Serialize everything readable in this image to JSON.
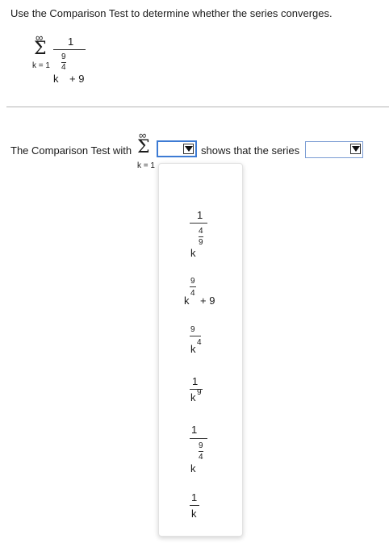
{
  "question": {
    "prompt": "Use the Comparison Test to determine whether the series converges.",
    "series": {
      "sum_upper": "∞",
      "sum_symbol": "Σ",
      "sum_lower": "k = 1",
      "numerator": "1",
      "base": "k",
      "exp_num": "9",
      "exp_den": "4",
      "tail": "+ 9"
    }
  },
  "answer": {
    "lead_text": "The Comparison Test with",
    "sum_upper": "∞",
    "sum_symbol": "Σ",
    "sum_lower": "k = 1",
    "middle_text": "shows that the series",
    "select1_value": "",
    "select2_value": ""
  },
  "dropdown_options": [
    {
      "id": "opt-1",
      "label": "1 / k^(4/9)",
      "numerator": "1",
      "base": "k",
      "exp_num": "4",
      "exp_den": "9"
    },
    {
      "id": "opt-2",
      "label": "k^(9/4) + 9 over 9",
      "numerator": "9",
      "base": "k",
      "exp": "4",
      "tail": "+ 9"
    },
    {
      "id": "opt-3",
      "label": "9 / k^4",
      "numerator": "9",
      "base": "k",
      "exp": "4"
    },
    {
      "id": "opt-4",
      "label": "1 / k^9",
      "numerator": "1",
      "base": "k",
      "exp": "9"
    },
    {
      "id": "opt-5",
      "label": "1 / k^(9/4)",
      "numerator": "1",
      "base": "k",
      "exp_num": "9",
      "exp_den": "4"
    },
    {
      "id": "opt-6",
      "label": "1 / k",
      "numerator": "1",
      "base": "k"
    }
  ]
}
